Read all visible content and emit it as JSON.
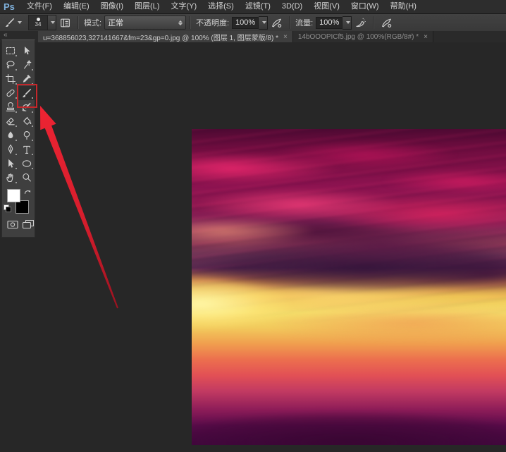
{
  "app": {
    "logo": "Ps"
  },
  "menu": {
    "items": [
      "文件(F)",
      "编辑(E)",
      "图像(I)",
      "图层(L)",
      "文字(Y)",
      "选择(S)",
      "滤镜(T)",
      "3D(D)",
      "视图(V)",
      "窗口(W)",
      "帮助(H)"
    ]
  },
  "options": {
    "brush_size": "34",
    "mode_label": "模式:",
    "mode_value": "正常",
    "opacity_label": "不透明度:",
    "opacity_value": "100%",
    "flow_label": "流量:",
    "flow_value": "100%"
  },
  "tabs": [
    {
      "title": "u=368856023,327141667&fm=23&gp=0.jpg @ 100% (图层 1, 图层蒙版/8) *",
      "close": "×",
      "active": true
    },
    {
      "title": "14bOOOPICf5.jpg @ 100%(RGB/8#) *",
      "close": "×",
      "active": false
    }
  ],
  "tools_panel": {
    "collapse": "«",
    "active_tool": "brush",
    "tools": [
      "rectangular-marquee",
      "move",
      "lasso",
      "magic-wand",
      "crop",
      "eyedropper",
      "spot-healing-brush",
      "brush",
      "clone-stamp",
      "history-brush",
      "eraser",
      "paint-bucket",
      "blur",
      "dodge",
      "pen",
      "horizontal-type",
      "path-selection",
      "ellipse-shape",
      "hand",
      "zoom"
    ],
    "foreground_color": "#ffffff",
    "background_color": "#000000"
  },
  "annotations": {
    "highlighted_tool": "brush",
    "highlight_color": "#c4272b",
    "arrow_color": "#e01f2f"
  },
  "canvas": {
    "content": "sunset-clouds-photo",
    "palette": {
      "top_maroon": "#6e0d3f",
      "crimson": "#e02258",
      "mid_dark_cloud": "#34143a",
      "yellow_glow": "#f6e16b",
      "orange": "#ec6f4e",
      "bottom_purple": "#470844"
    }
  }
}
